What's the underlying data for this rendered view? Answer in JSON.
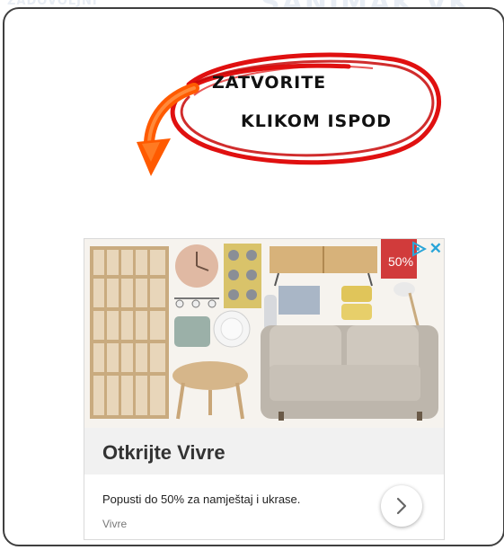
{
  "background": {
    "ghost_left": "ZADOVOLJNI",
    "ghost_right": "SANIMAK VK"
  },
  "annotation": {
    "line1": "ZATVORITE",
    "line2": "KLIKOM ISPOD",
    "ring_color": "#e01010",
    "arrow_color": "#ff5a00"
  },
  "ad": {
    "discount_badge": "50%",
    "title": "Otkrijte Vivre",
    "description": "Popusti do 50% za namještaj i ukrase.",
    "advertiser": "Vivre",
    "badge_color": "#2aa5d8",
    "icons": [
      "adchoices-icon",
      "close-icon",
      "chevron-right-icon"
    ]
  }
}
